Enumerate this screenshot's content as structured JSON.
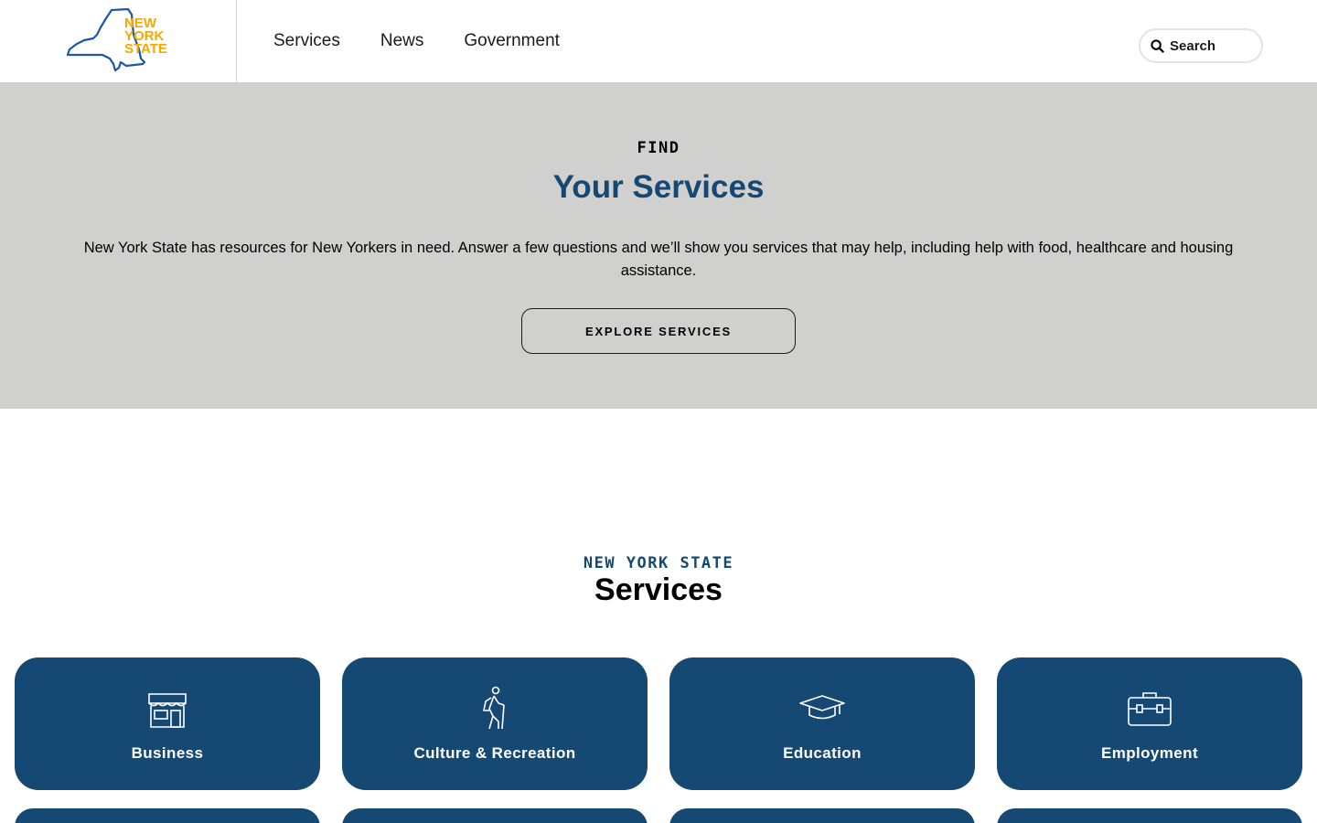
{
  "header": {
    "logo_text": "NEW YORK STATE",
    "nav": [
      "Services",
      "News",
      "Government"
    ],
    "search_label": "Search"
  },
  "hero": {
    "eyebrow": "FIND",
    "title": "Your Services",
    "description": "New York State has resources for New Yorkers in need. Answer a few questions and we’ll show you services that may help, including help with food, healthcare and housing assistance.",
    "button": "EXPLORE SERVICES"
  },
  "services": {
    "eyebrow": "NEW YORK STATE",
    "title": "Services",
    "cards": [
      {
        "label": "Business",
        "icon": "storefront-icon"
      },
      {
        "label": "Culture & Recreation",
        "icon": "hiker-icon"
      },
      {
        "label": "Education",
        "icon": "graduation-cap-icon"
      },
      {
        "label": "Employment",
        "icon": "briefcase-icon"
      }
    ]
  },
  "colors": {
    "brand_blue": "#154973",
    "hero_bg": "#d0d0ce",
    "logo_yellow": "#f5a800",
    "logo_outline": "#1c57a8"
  }
}
